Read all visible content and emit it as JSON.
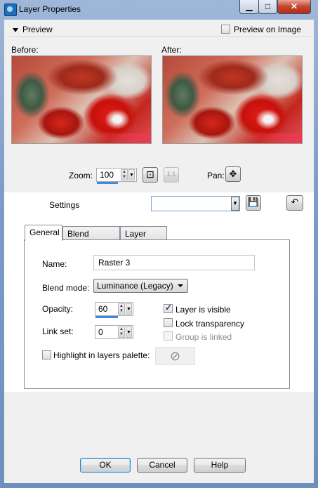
{
  "window": {
    "title": "Layer Properties",
    "buttons": {
      "minimize": "▁",
      "maximize": "□",
      "close": "✕"
    }
  },
  "preview": {
    "header_label": "Preview",
    "preview_on_image_label": "Preview on Image",
    "preview_on_image_checked": false,
    "before_label": "Before:",
    "after_label": "After:",
    "zoom_label": "Zoom:",
    "zoom_value": "100",
    "pan_label": "Pan:"
  },
  "settings": {
    "label": "Settings",
    "value": ""
  },
  "tabs": [
    {
      "label": "General",
      "active": true
    },
    {
      "label": "Blend Ranges",
      "active": false
    },
    {
      "label": "Layer Styles",
      "active": false
    }
  ],
  "general": {
    "name_label": "Name:",
    "name_value": "Raster 3",
    "blend_mode_label": "Blend mode:",
    "blend_mode_value": "Luminance (Legacy)",
    "opacity_label": "Opacity:",
    "opacity_value": "60",
    "opacity_fraction": 0.6,
    "link_set_label": "Link set:",
    "link_set_value": "0",
    "layer_visible_label": "Layer is visible",
    "layer_visible_checked": true,
    "lock_transparency_label": "Lock transparency",
    "lock_transparency_checked": false,
    "group_linked_label": "Group is linked",
    "group_linked_checked": false,
    "highlight_label": "Highlight in layers palette:",
    "highlight_checked": false
  },
  "footer": {
    "ok_label": "OK",
    "cancel_label": "Cancel",
    "help_label": "Help"
  },
  "colors": {
    "accent": "#3b8be0",
    "window_frame": "#7f9cc6",
    "close_button": "#c5452d"
  }
}
